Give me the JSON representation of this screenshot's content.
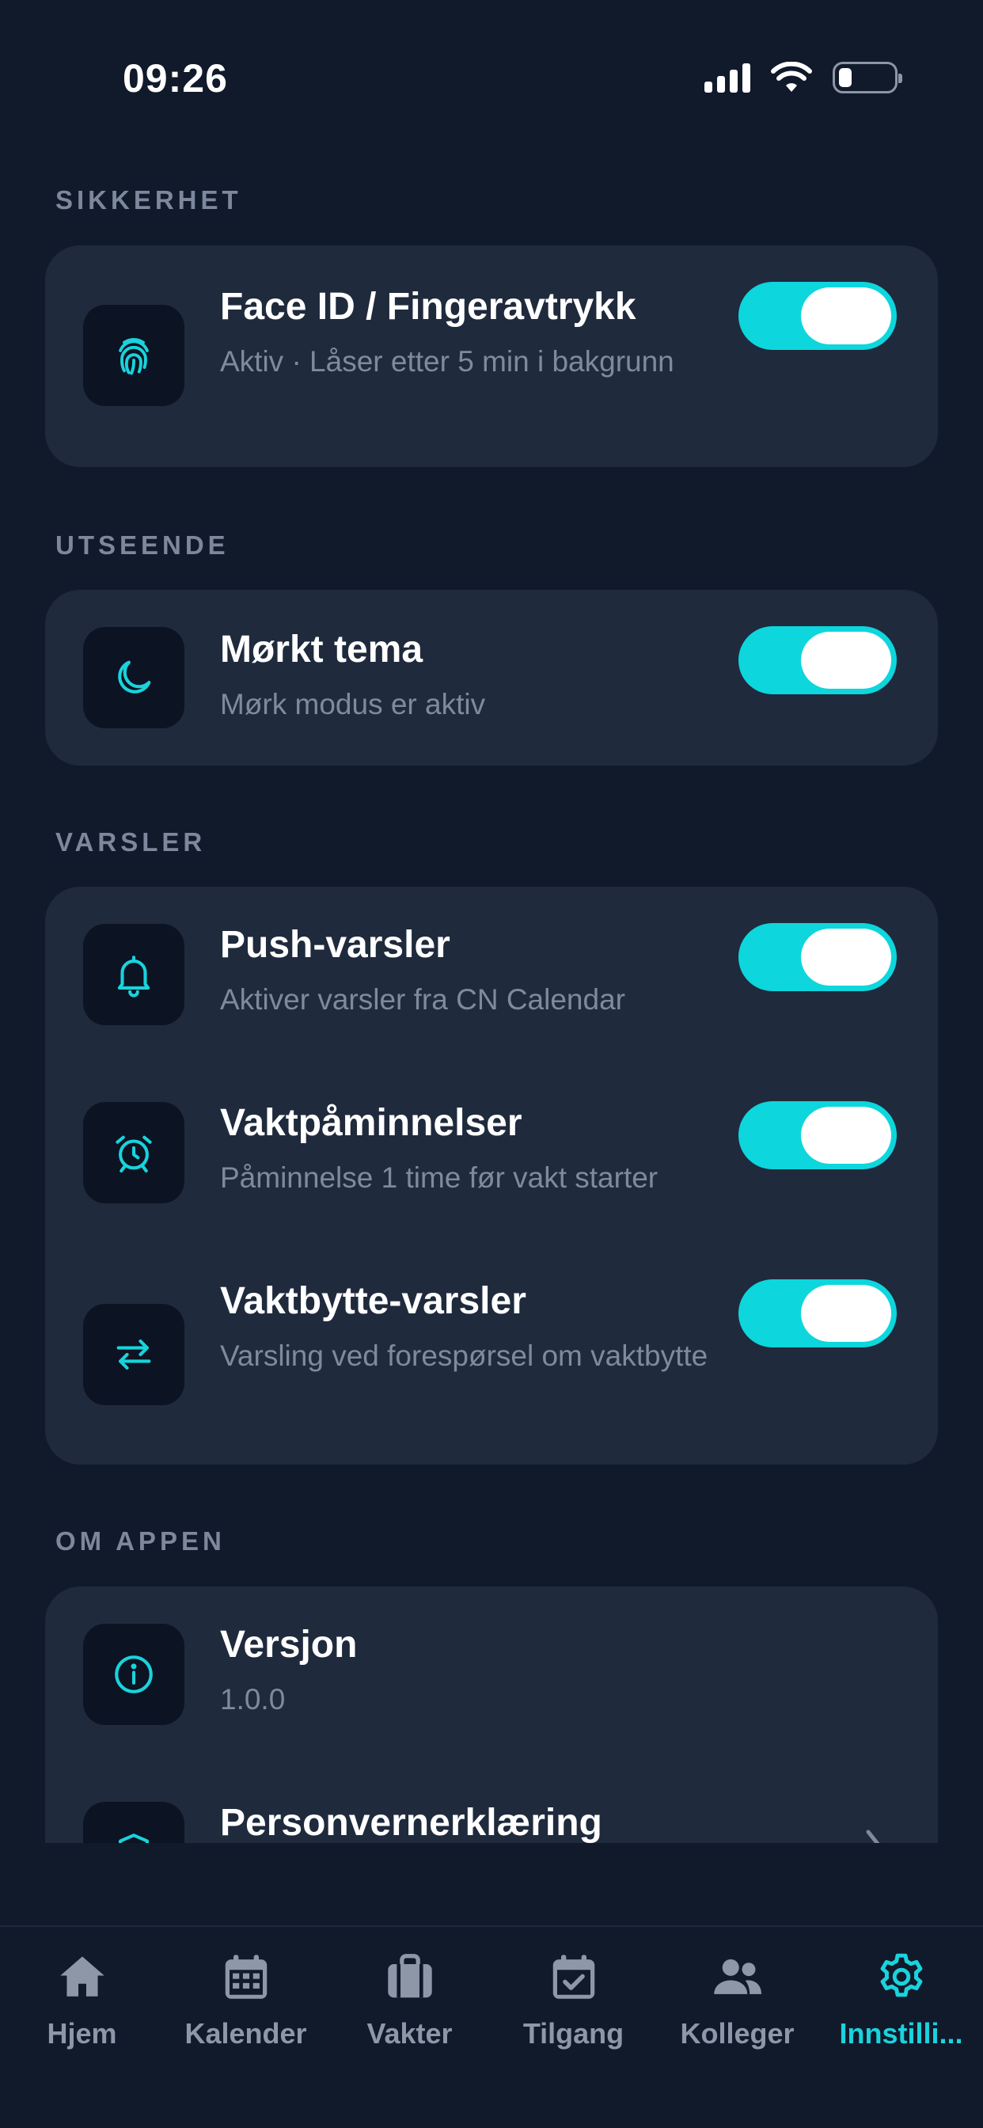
{
  "status_bar": {
    "time": "09:26",
    "signal_icon": "cellular-signal-icon",
    "wifi_icon": "wifi-icon",
    "battery_icon": "battery-low-icon"
  },
  "colors": {
    "background": "#111a2b",
    "card": "#1f2a3d",
    "accent": "#0dd6dc",
    "section_title": "#7d889c",
    "subtitle": "#7f8a9d",
    "tab_inactive": "#8d97a8"
  },
  "sections": {
    "security": {
      "title": "SIKKERHET",
      "items": [
        {
          "icon": "fingerprint-icon",
          "title": "Face ID / Fingeravtrykk",
          "subtitle": "Aktiv · Låser etter 5 min i bakgrunn",
          "toggle_on": true
        }
      ]
    },
    "appearance": {
      "title": "UTSEENDE",
      "items": [
        {
          "icon": "moon-icon",
          "title": "Mørkt tema",
          "subtitle": "Mørk modus er aktiv",
          "toggle_on": true
        }
      ]
    },
    "notifications": {
      "title": "VARSLER",
      "items": [
        {
          "icon": "bell-icon",
          "title": "Push-varsler",
          "subtitle": "Aktiver varsler fra CN Calendar",
          "toggle_on": true
        },
        {
          "icon": "alarm-clock-icon",
          "title": "Vaktpåminnelser",
          "subtitle": "Påminnelse 1 time før vakt starter",
          "toggle_on": true
        },
        {
          "icon": "swap-arrows-icon",
          "title": "Vaktbytte-varsler",
          "subtitle": "Varsling ved forespørsel om vaktbytte",
          "toggle_on": true
        }
      ]
    },
    "about": {
      "title": "OM APPEN",
      "items": [
        {
          "icon": "info-icon",
          "title": "Versjon",
          "subtitle": "1.0.0"
        },
        {
          "icon": "shield-icon",
          "title": "Personvernerklæring",
          "chevron_icon": "chevron-right-icon"
        }
      ]
    }
  },
  "tab_bar": {
    "tabs": [
      {
        "icon": "home-icon",
        "label": "Hjem",
        "active": false
      },
      {
        "icon": "calendar-icon",
        "label": "Kalender",
        "active": false
      },
      {
        "icon": "briefcase-icon",
        "label": "Vakter",
        "active": false
      },
      {
        "icon": "calendar-check-icon",
        "label": "Tilgang",
        "active": false
      },
      {
        "icon": "people-icon",
        "label": "Kolleger",
        "active": false
      },
      {
        "icon": "gear-icon",
        "label": "Innstilli...",
        "active": true
      }
    ]
  }
}
